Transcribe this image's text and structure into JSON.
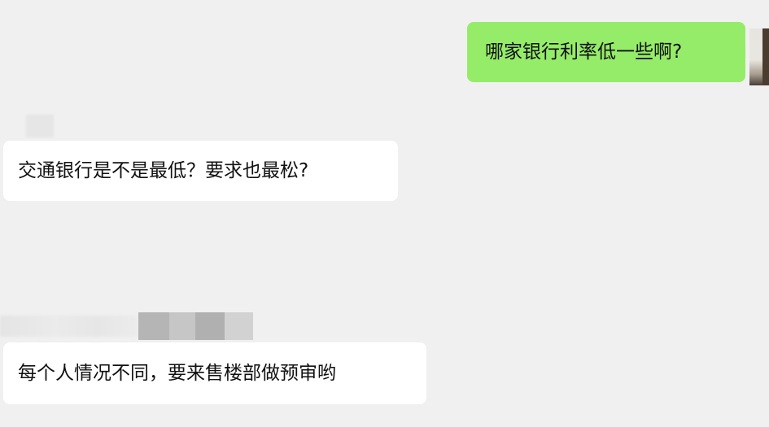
{
  "chat": {
    "messages": [
      {
        "side": "sent",
        "text": "哪家银行利率低一些啊?"
      },
      {
        "side": "received",
        "text": "交通银行是不是最低？要求也最松?"
      },
      {
        "side": "received",
        "text": "每个人情况不同，要来售楼部做预审哟"
      }
    ]
  },
  "colors": {
    "background": "#f0f0f0",
    "sent_bubble": "#95ec69",
    "received_bubble": "#ffffff",
    "text": "#111111"
  }
}
